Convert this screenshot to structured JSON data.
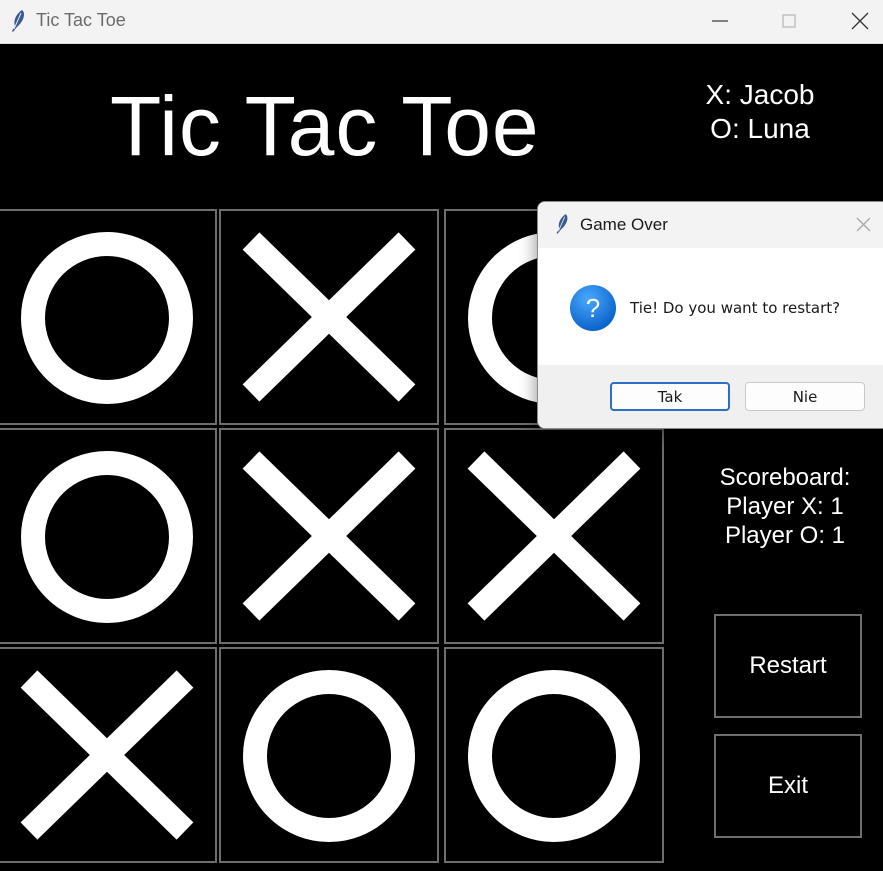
{
  "window": {
    "title": "Tic Tac Toe"
  },
  "game": {
    "title": "Tic Tac Toe",
    "players": {
      "x_label": "X: Jacob",
      "o_label": "O: Luna"
    },
    "board": [
      [
        "O",
        "X",
        "O"
      ],
      [
        "O",
        "X",
        "X"
      ],
      [
        "X",
        "O",
        "O"
      ]
    ],
    "scoreboard": {
      "heading": "Scoreboard:",
      "player_x": "Player X: 1",
      "player_o": "Player O: 1"
    },
    "buttons": {
      "restart": "Restart",
      "exit": "Exit"
    }
  },
  "dialog": {
    "title": "Game Over",
    "message": "Tie! Do you want to restart?",
    "yes_label": "Tak",
    "no_label": "Nie",
    "icon": "question-icon"
  },
  "colors": {
    "background": "#000000",
    "mark": "#ffffff",
    "cell_border": "#6e6e6e",
    "dialog_accent": "#2c6fc4"
  }
}
